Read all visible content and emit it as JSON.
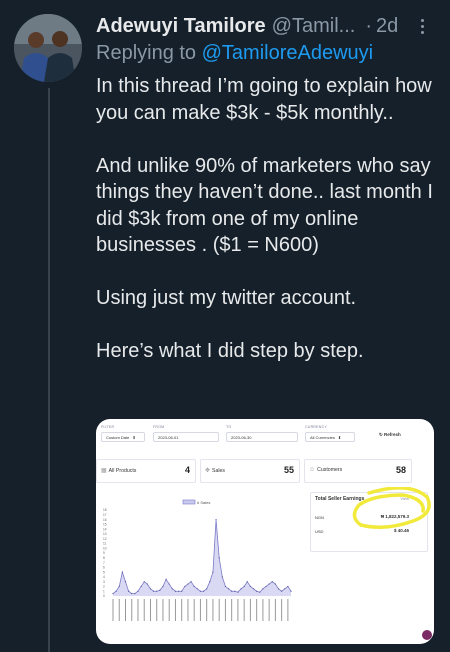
{
  "tweet": {
    "author_name": "Adewuyi Tamilore",
    "author_handle": "@Tamil...",
    "dot": "·",
    "time": "2d",
    "reply_prefix": "Replying to",
    "reply_handle": "@TamiloreAdewuyi",
    "paragraphs": [
      "In this thread I’m going to explain how you can make $3k - $5k monthly..",
      "And unlike 90% of marketers who say things they haven’t done.. last month I did $3k from one of my online businesses . ($1 = N600)",
      "Using just my twitter account.",
      "Here’s what I did step by step."
    ]
  },
  "dashboard": {
    "filters": {
      "filter_label": "FILTER",
      "filter_value": "Custom Date",
      "from_label": "FROM",
      "from_value": "2023-06-01",
      "to_label": "TO",
      "to_value": "2023-06-30",
      "currency_label": "CURRENCY",
      "currency_value": "All Currencies",
      "refresh": "Refresh"
    },
    "cards": [
      {
        "label": "All Products",
        "value": "4"
      },
      {
        "label": "Sales",
        "value": "55"
      },
      {
        "label": "Customers",
        "value": "58"
      }
    ],
    "chart": {
      "legend": "# Sales",
      "y_ticks": [
        "18",
        "17",
        "16",
        "15",
        "14",
        "13",
        "12",
        "11",
        "10",
        "9",
        "8",
        "7",
        "6",
        "5",
        "4",
        "3",
        "2",
        "1",
        "0"
      ],
      "line_color": "#7a7ac6",
      "fill_color": "#c9c9ee"
    },
    "earnings": {
      "title": "Total Seller Earnings",
      "view": "View",
      "rows": [
        {
          "currency": "NGN",
          "amount": "₦ 1,822,579.3"
        },
        {
          "currency": "USD",
          "amount": "$ 40.46"
        }
      ]
    },
    "highlight_color": "#f2ea3a"
  },
  "chart_data": {
    "type": "area",
    "ylim": [
      0,
      18
    ],
    "legend": [
      "# Sales"
    ],
    "series": [
      {
        "name": "# Sales",
        "values": [
          0.5,
          1,
          2,
          5,
          3,
          1,
          0.5,
          0.5,
          1,
          2,
          3,
          2.5,
          1.5,
          1,
          1,
          1.2,
          2,
          3.5,
          2.5,
          1.5,
          1,
          1,
          1,
          2,
          2.5,
          3,
          2,
          1.5,
          1,
          1,
          1.5,
          3,
          5,
          16,
          8,
          4,
          2,
          1.5,
          1,
          1,
          0.8,
          1.5,
          2,
          3,
          2,
          1.5,
          1,
          0.8,
          1.5,
          2,
          2.5,
          3,
          2.5,
          1.5,
          1,
          1.5,
          2,
          1
        ]
      }
    ]
  }
}
